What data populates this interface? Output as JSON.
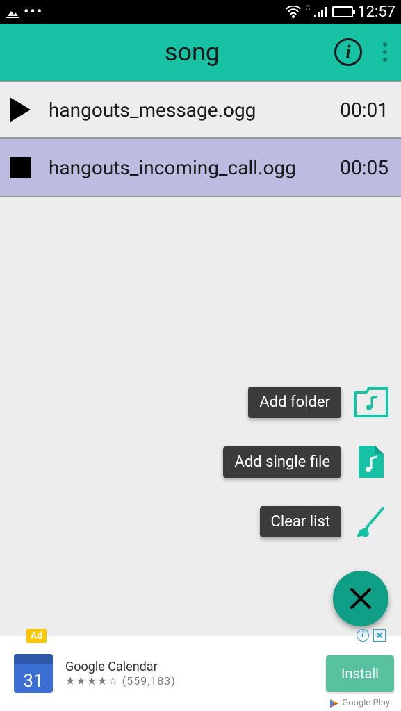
{
  "status": {
    "time": "12:57",
    "signal_label": "G"
  },
  "appbar": {
    "title": "song"
  },
  "tracks": [
    {
      "name": "hangouts_message.ogg",
      "duration": "00:01",
      "state": "play",
      "selected": false
    },
    {
      "name": "hangouts_incoming_call.ogg",
      "duration": "00:05",
      "state": "stop",
      "selected": true
    }
  ],
  "fab": {
    "items": [
      {
        "label": "Add folder",
        "icon": "folder-music-icon"
      },
      {
        "label": "Add single file",
        "icon": "file-music-icon"
      },
      {
        "label": "Clear list",
        "icon": "broom-icon"
      }
    ]
  },
  "ad": {
    "badge": "Ad",
    "title": "Google Calendar",
    "stars": "★★★★☆",
    "reviews": "(559,183)",
    "cta": "Install",
    "store": "Google Play",
    "calendar_day": "31"
  }
}
